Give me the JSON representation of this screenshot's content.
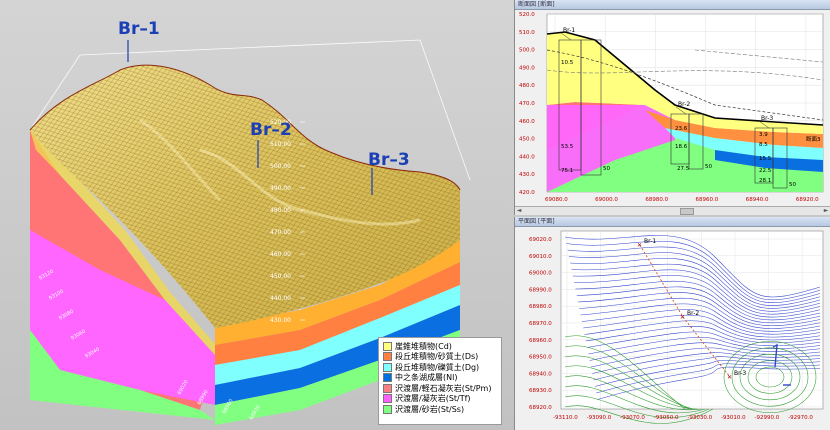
{
  "view3d": {
    "boreholes": [
      {
        "label": "Br–1"
      },
      {
        "label": "Br–2"
      },
      {
        "label": "Br–3"
      }
    ],
    "elev_ticks": [
      "520.00",
      "510.00",
      "500.00",
      "490.00",
      "480.00",
      "470.00",
      "460.00",
      "450.00",
      "440.00",
      "430.00"
    ]
  },
  "legend": {
    "items": [
      {
        "label": "崖錐堆積物(Cd)",
        "color": "#ffff80"
      },
      {
        "label": "段丘堆積物/砂質土(Ds)",
        "color": "#ff8040"
      },
      {
        "label": "段丘堆積物/礫質土(Dg)",
        "color": "#80ffff"
      },
      {
        "label": "中之条湖成層(Nl)",
        "color": "#0070e0"
      },
      {
        "label": "沢渡層/軽石凝灰岩(St/Pm)",
        "color": "#ff8080"
      },
      {
        "label": "沢渡層/凝灰岩(St/Tf)",
        "color": "#ff60ff"
      },
      {
        "label": "沢渡層/砂岩(St/Ss)",
        "color": "#80ff80"
      }
    ]
  },
  "section": {
    "title": "断面図 [断面]",
    "y_ticks": [
      "520.0",
      "510.0",
      "500.0",
      "490.0",
      "480.0",
      "470.0",
      "460.0",
      "450.0",
      "440.0",
      "430.0",
      "420.0"
    ],
    "x_ticks": [
      "69080.0",
      "69000.0",
      "68980.0",
      "68960.0",
      "68940.0",
      "68920.0"
    ],
    "boreholes": [
      "Br-1",
      "Br-2",
      "Br-3"
    ],
    "depth_labels": [
      "10.5",
      "53.5",
      "75.1",
      "50",
      "23.6",
      "18.6",
      "27.5",
      "50",
      "3.9",
      "8.5",
      "15.5",
      "22.5",
      "28.1",
      "50"
    ],
    "end_label": "断面3"
  },
  "plan": {
    "title": "平面図 [平面]",
    "y_ticks": [
      "69020.0",
      "69010.0",
      "69000.0",
      "68990.0",
      "68980.0",
      "68970.0",
      "68960.0",
      "68950.0",
      "68940.0",
      "68930.0",
      "68920.0"
    ],
    "x_ticks": [
      "-93110.0",
      "-93090.0",
      "-93070.0",
      "-93050.0",
      "-93030.0",
      "-93010.0",
      "-92990.0",
      "-92970.0"
    ],
    "boreholes": [
      "Br-1",
      "Br-2",
      "Br-3"
    ]
  }
}
